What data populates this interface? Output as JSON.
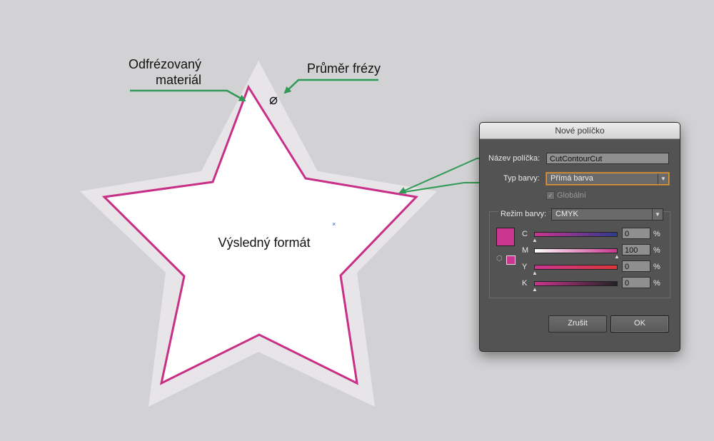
{
  "annotations": {
    "milled_material_line1": "Odfrézovaný",
    "milled_material_line2": "materiál",
    "cutter_diameter": "Průměr frézy",
    "diameter_symbol": "⌀",
    "final_format": "Výsledný formát"
  },
  "colors": {
    "background": "#d2d2d4",
    "outer_star": "#e7e5e8",
    "inner_star": "#ffffff",
    "cut_line": "#c82f86",
    "arrow": "#2f9a55"
  },
  "dialog": {
    "title": "Nové políčko",
    "swatch_name_label": "Název políčka:",
    "swatch_name_value": "CutContourCut",
    "color_type_label": "Typ barvy:",
    "color_type_value": "Přímá barva",
    "global_label": "Globální",
    "global_checked": true,
    "color_mode_label": "Režim barvy:",
    "color_mode_value": "CMYK",
    "channels": [
      {
        "label": "C",
        "value": "0",
        "unit": "%"
      },
      {
        "label": "M",
        "value": "100",
        "unit": "%"
      },
      {
        "label": "Y",
        "value": "0",
        "unit": "%"
      },
      {
        "label": "K",
        "value": "0",
        "unit": "%"
      }
    ],
    "cancel_label": "Zrušit",
    "ok_label": "OK"
  }
}
